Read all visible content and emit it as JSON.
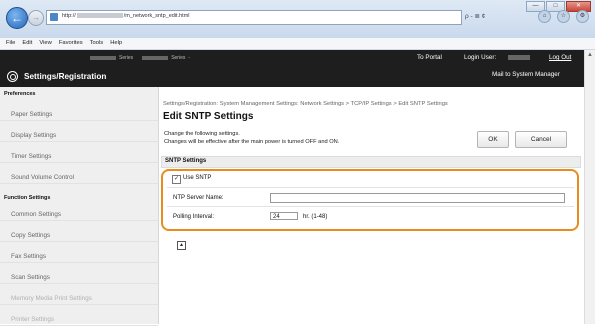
{
  "browser": {
    "url_prefix": "http://",
    "url_suffix": "/m_network_sntp_edit.html",
    "addr_tools": "ρ - ≣ ¢",
    "menu": [
      "File",
      "Edit",
      "View",
      "Favorites",
      "Tools",
      "Help"
    ],
    "window_controls": [
      "—",
      "□",
      "✕"
    ]
  },
  "header": {
    "series_left": "Series",
    "series_right": "Series",
    "to_portal": "To Portal",
    "login_user": "Login User:",
    "log_out": "Log Out",
    "mail": "Mail to System Manager",
    "title": "Settings/Registration"
  },
  "sidebar": {
    "preferences_label": "Preferences",
    "preferences_items": [
      "Paper Settings",
      "Display Settings",
      "Timer Settings",
      "Sound Volume Control"
    ],
    "function_label": "Function Settings",
    "function_items": [
      "Common Settings",
      "Copy Settings",
      "Fax Settings",
      "Scan Settings",
      "Memory Media Print Settings",
      "Printer Settings"
    ]
  },
  "main": {
    "breadcrumb": "Settings/Registration: System Management Settings: Network Settings > TCP/IP Settings > Edit SNTP Settings",
    "title": "Edit SNTP Settings",
    "instruction_1": "Change the following settings.",
    "instruction_2": "Changes will be effective after the main power is turned OFF and ON.",
    "ok_label": "OK",
    "cancel_label": "Cancel",
    "section_title": "SNTP Settings",
    "use_sntp_label": "Use SNTP",
    "use_sntp_checked": true,
    "ntp_server_label": "NTP Server Name:",
    "ntp_server_value": "",
    "polling_label": "Polling Interval:",
    "polling_value": "24",
    "polling_unit": "hr. (1-48)"
  }
}
